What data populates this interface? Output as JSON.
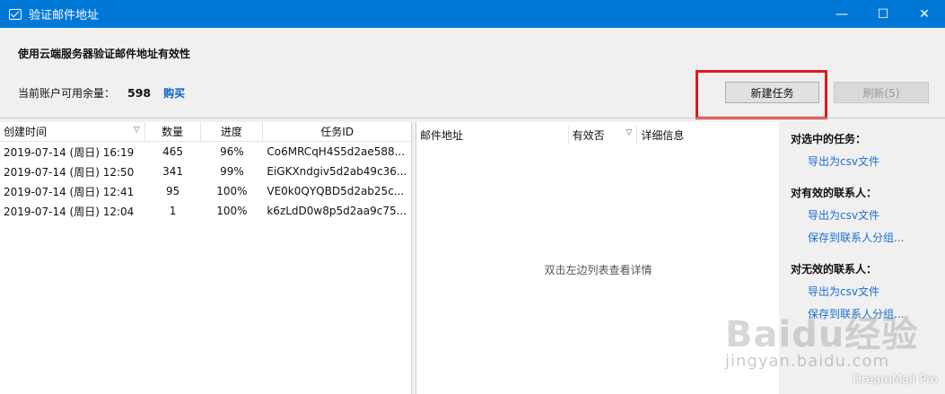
{
  "window": {
    "title": "验证邮件地址",
    "controls": [
      "—",
      "☐",
      "✕"
    ]
  },
  "header": {
    "heading": "使用云端服务器验证邮件地址有效性",
    "quota_label": "当前账户可用余量：",
    "quota_value": "598",
    "buy_label": "购买"
  },
  "toolbar": {
    "new_task_label": "新建任务",
    "refresh_label": "刷新(5)"
  },
  "task_table": {
    "columns": [
      "创建时间",
      "数量",
      "进度",
      "任务ID"
    ],
    "rows": [
      [
        "2019-07-14 (周日) 16:19",
        "465",
        "96%",
        "Co6MRCqH4S5d2ae588..."
      ],
      [
        "2019-07-14 (周日) 12:50",
        "341",
        "99%",
        "EiGKXndgiv5d2ab49c36..."
      ],
      [
        "2019-07-14 (周日) 12:41",
        "95",
        "100%",
        "VE0k0QYQBD5d2ab25c..."
      ],
      [
        "2019-07-14 (周日) 12:04",
        "1",
        "100%",
        "k6zLdD0w8p5d2aa9c75..."
      ]
    ]
  },
  "detail_table": {
    "columns": [
      "邮件地址",
      "有效否",
      "详细信息"
    ],
    "empty_hint": "双击左边列表查看详情"
  },
  "actions": {
    "selected_title": "对选中的任务：",
    "selected_export": "导出为csv文件",
    "valid_title": "对有效的联系人：",
    "valid_export": "导出为csv文件",
    "valid_save": "保存到联系人分组...",
    "invalid_title": "对无效的联系人：",
    "invalid_export": "导出为csv文件",
    "invalid_save": "保存到联系人分组..."
  },
  "watermark": {
    "logo": "Baidu经验",
    "url": "jingyan.baidu.com"
  },
  "brand": "DreamMail Pro",
  "colors": {
    "titlebar": "#0078d7",
    "link": "#1a6fd1",
    "highlight": "#e01a1a"
  }
}
